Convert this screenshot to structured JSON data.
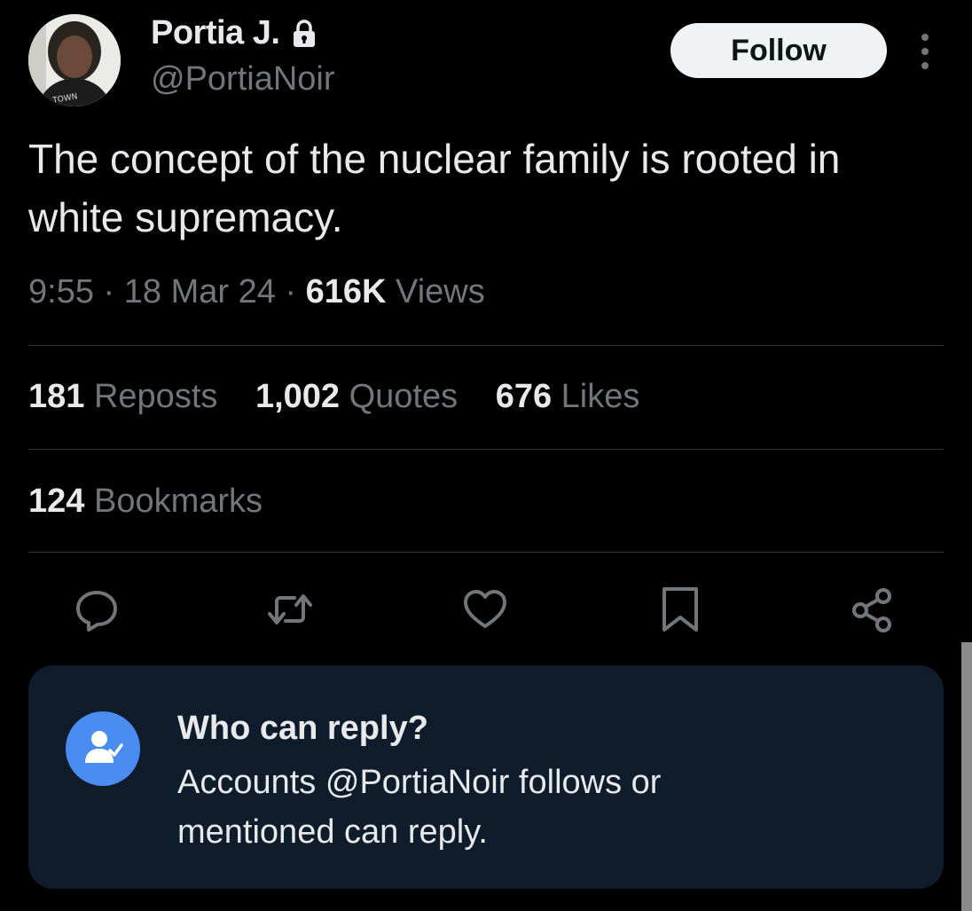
{
  "author": {
    "name": "Portia J.",
    "handle": "@PortiaNoir",
    "protected_icon": "lock-icon",
    "avatar_shirt_text": "TOWN"
  },
  "follow_button": {
    "label": "Follow"
  },
  "more_icon": "more-vertical-icon",
  "tweet": {
    "text": "The concept of the nuclear family is rooted in white supremacy."
  },
  "meta": {
    "time": "9:55",
    "separator": "·",
    "date": "18 Mar 24",
    "views_count": "616K",
    "views_label": "Views"
  },
  "stats": [
    {
      "count": "181",
      "label": "Reposts"
    },
    {
      "count": "1,002",
      "label": "Quotes"
    },
    {
      "count": "676",
      "label": "Likes"
    }
  ],
  "bookmarks": {
    "count": "124",
    "label": "Bookmarks"
  },
  "actions": [
    {
      "icon": "reply-icon"
    },
    {
      "icon": "repost-icon"
    },
    {
      "icon": "like-icon"
    },
    {
      "icon": "bookmark-icon"
    },
    {
      "icon": "share-icon"
    }
  ],
  "who_can_reply": {
    "icon": "user-check-icon",
    "title": "Who can reply?",
    "description": "Accounts @PortiaNoir follows or mentioned can reply."
  },
  "colors": {
    "background": "#000000",
    "text_primary": "#e7e9ea",
    "text_secondary": "#71767b",
    "divider": "#2f3336",
    "card_background": "#0f1c2b",
    "accent_blue": "#4a8df0",
    "follow_button_bg": "#eff3f4"
  }
}
